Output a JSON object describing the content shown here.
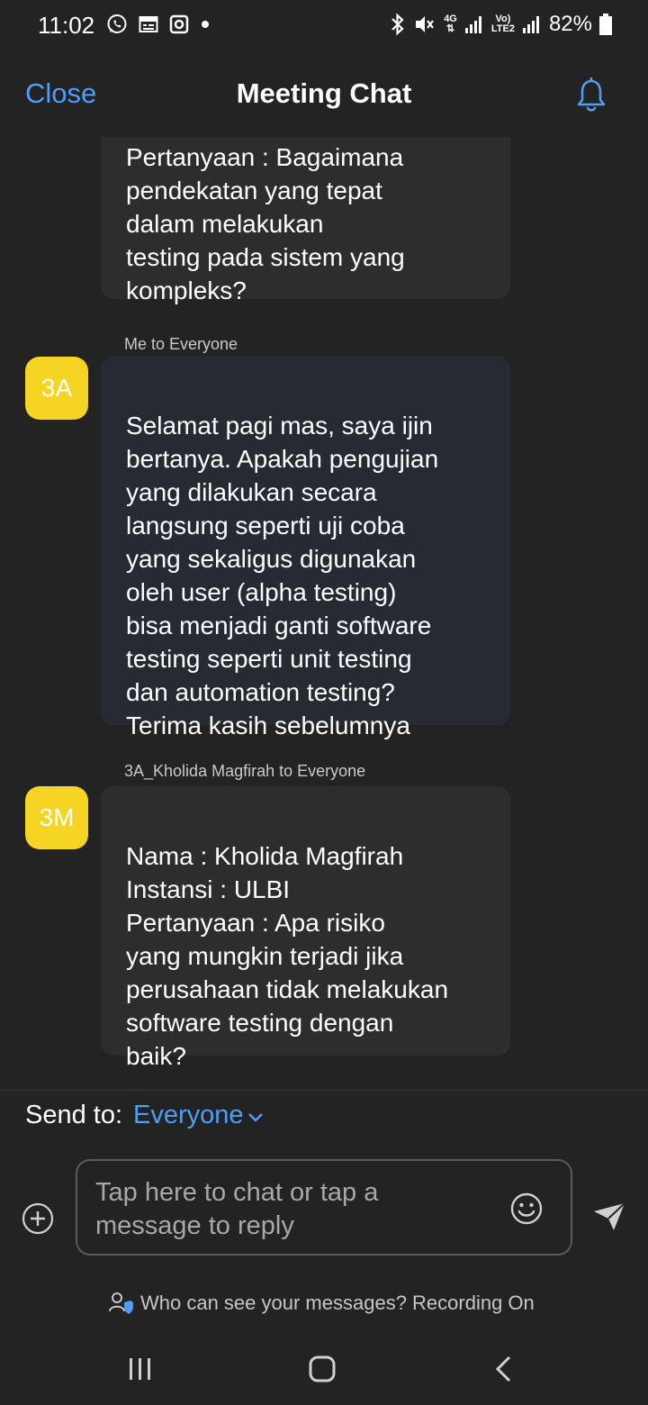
{
  "status_bar": {
    "time": "11:02",
    "network_top": "4G",
    "network_bottom": "⇅",
    "volte_top": "Vo)",
    "volte_bottom": "LTE2",
    "battery": "82%"
  },
  "header": {
    "close_label": "Close",
    "title": "Meeting Chat"
  },
  "messages": [
    {
      "sender": "",
      "avatar": "",
      "text": "Pertanyaan : Bagaimana\npendekatan yang tepat\ndalam melakukan\ntesting pada sistem yang\nkompleks?"
    },
    {
      "sender": "Me to Everyone",
      "avatar": "3A",
      "text": "Selamat pagi mas, saya ijin\nbertanya. Apakah pengujian\nyang dilakukan secara\nlangsung seperti uji coba\nyang sekaligus digunakan\noleh user (alpha testing)\nbisa menjadi ganti software\ntesting seperti unit testing\ndan automation testing?\nTerima kasih sebelumnya"
    },
    {
      "sender": "3A_Kholida Magfirah to Everyone",
      "avatar": "3M",
      "text": "Nama : Kholida Magfirah\nInstansi : ULBI\nPertanyaan : Apa risiko\nyang mungkin terjadi jika\nperusahaan tidak melakukan\nsoftware testing dengan\nbaik?"
    }
  ],
  "composer": {
    "send_to_label": "Send to:",
    "recipient": "Everyone",
    "placeholder": "Tap here to chat or tap a\nmessage to reply",
    "privacy_text": "Who can see your messages? Recording On"
  },
  "colors": {
    "accent": "#4f9df5",
    "avatar": "#f5d424",
    "background": "#232323",
    "bubble": "#2d2d2d",
    "bubble_me": "#252a33"
  },
  "icons": {
    "bell": "bell-icon",
    "plus": "plus-circle-icon",
    "emoji": "emoji-icon",
    "send": "send-icon",
    "privacy": "person-shield-icon"
  }
}
